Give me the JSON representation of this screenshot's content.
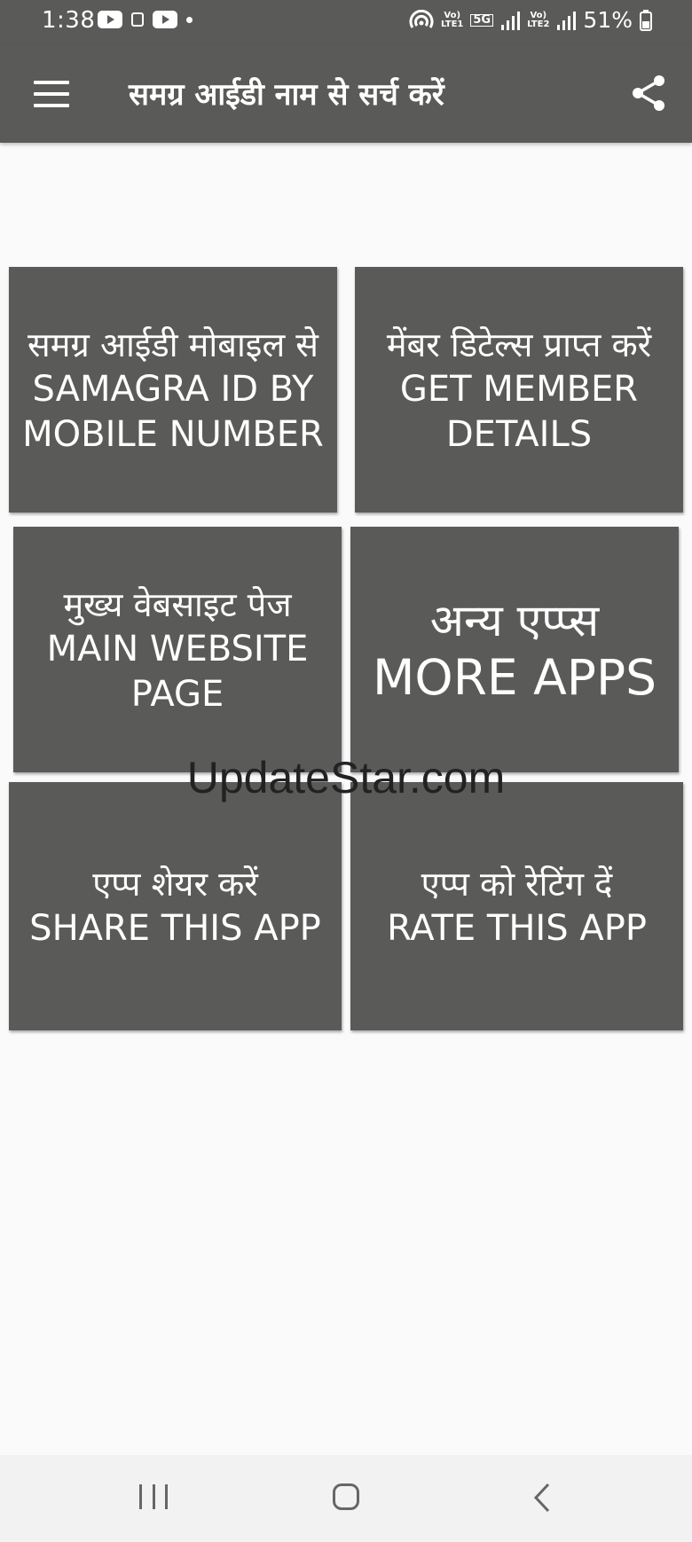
{
  "status_bar": {
    "time": "1:38",
    "battery": "51%",
    "sim1_label": "Vo)\nLTE1",
    "network_label": "5G",
    "sim2_label": "Vo)\nLTE2"
  },
  "app_bar": {
    "title": "समग्र आईडी नाम से सर्च करें"
  },
  "tiles": [
    {
      "hindi": "समग्र आईडी मोबाइल से",
      "english": "SAMAGRA ID BY MOBILE NUMBER"
    },
    {
      "hindi": "मेंबर डिटेल्स प्राप्त करें",
      "english": "GET MEMBER DETAILS"
    },
    {
      "hindi": "मुख्य वेबसाइट पेज",
      "english": "MAIN WEBSITE PAGE"
    },
    {
      "hindi": "अन्य एप्प्स",
      "english": "MORE APPS"
    },
    {
      "hindi": "एप्प शेयर करें",
      "english": "SHARE THIS APP"
    },
    {
      "hindi": "एप्प को रेटिंग दें",
      "english": "RATE THIS APP"
    }
  ],
  "watermark": "UpdateStar.com",
  "colors": {
    "bar": "#5a5b59",
    "tile": "#5a5b59",
    "background": "#fafafa",
    "nav": "#f2f2f2"
  }
}
